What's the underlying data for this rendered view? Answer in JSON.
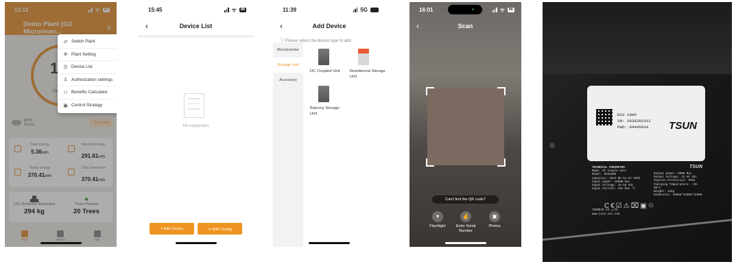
{
  "phone1": {
    "time": "13:12",
    "battery": "82",
    "title": "Demo Plant (G3 Microinver...",
    "gauge_value": "18",
    "gauge_label": "Cu",
    "weather": {
      "temp": "21°C",
      "desc": "Sunny"
    },
    "layout_btn": "Layout",
    "dropdown": [
      {
        "icon": "⇄",
        "label": "Switch Plant"
      },
      {
        "icon": "⊕",
        "label": "Plant Setting"
      },
      {
        "icon": "☰",
        "label": "Device List"
      },
      {
        "icon": "♙",
        "label": "Authorization settings"
      },
      {
        "icon": "⚇",
        "label": "Benefits Calculator"
      },
      {
        "icon": "▣",
        "label": "Control Strategy"
      }
    ],
    "energy": {
      "daily_label": "Daily Energy",
      "daily_value": "5.36",
      "daily_unit": "kWh",
      "monthly_label": "Monthly Energy",
      "monthly_value": "291.61",
      "monthly_unit": "kWh",
      "yearly_label": "Yearly Energy",
      "yearly_value": "370.41",
      "yearly_unit": "kWh",
      "total_label": "Total Generation",
      "total_value": "370.41",
      "total_unit": "kWh"
    },
    "co2": {
      "label": "CO₂ Emission Reduction",
      "value": "294 kg"
    },
    "trees": {
      "label": "Trees Planted",
      "value": "20 Trees"
    },
    "tabs": [
      "Plant",
      "Meters",
      "Me"
    ]
  },
  "phone2": {
    "time": "15:45",
    "battery": "88",
    "title": "Device List",
    "empty_text": "No equipment",
    "add_device": "+ Add Device",
    "wifi_config": "ᯤ WiFi Config"
  },
  "phone3": {
    "time": "11:39",
    "network": "5G",
    "title": "Add Device",
    "hint": "ⓘ Please select the device type to add",
    "categories": [
      "Microinverter",
      "Storage Unit",
      "Accessory"
    ],
    "devices": {
      "dc": "DC Coupled Unit",
      "residential": "Residencial Storage Unit",
      "balcony": "Balcony Storage Unit"
    }
  },
  "phone4": {
    "time": "16:01",
    "battery": "86",
    "title": "Scan",
    "qr_prompt": "Can't find the QR code?",
    "actions": [
      "Flashlight",
      "Enter Serial Number",
      "Photos"
    ]
  },
  "photo": {
    "model": "DCU 1000",
    "sn": "SN: 3938282312",
    "pwd": "PWD: 04445934",
    "brand": "TSUN",
    "tech_title": "TECHNICAL PARAMETER",
    "tech_left": [
      "Name: DC Couple Unit",
      "Model: DCU1000",
      "Capacity: 1024 Wh 51.2V 20Ah",
      "Input power: 1000W Max",
      "Input Voltage: 16-55 Vdc",
      "Input Current: 16A Max *2"
    ],
    "tech_right": [
      "Output power: 800W Max",
      "Output Voltage: 22-45 Vdc",
      "Ingress Protection: IP65",
      "Charging Temperature: -20-60°C",
      "Weight: 11Kg",
      "Dimension: 330mm*210mm*119mm"
    ],
    "maker": "TSUNESS CO.,LTD",
    "website": "www.tsun-ess.com"
  }
}
